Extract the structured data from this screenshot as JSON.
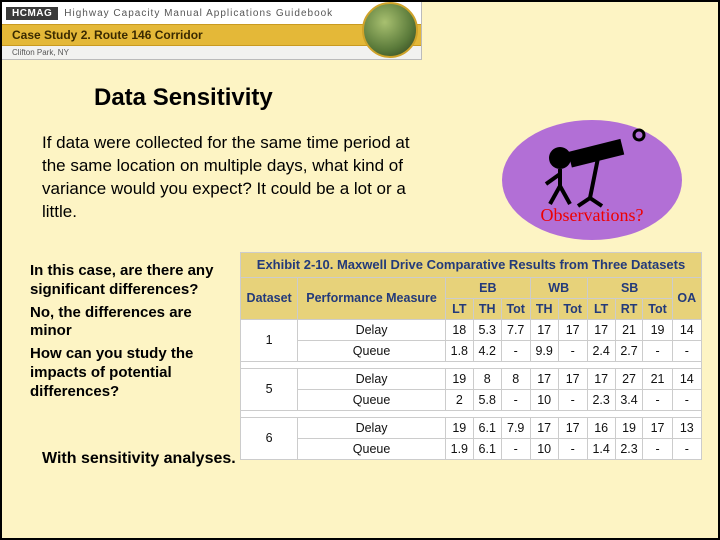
{
  "header": {
    "badge": "HCMAG",
    "line1": "Highway Capacity Manual Applications Guidebook",
    "line2": "Case Study 2. Route 146 Corridor",
    "line3": "Clifton Park, NY"
  },
  "title": "Data Sensitivity",
  "question1": "If data were collected for the same time period at the same location on multiple days, what kind of variance would you expect?",
  "answer1": "It could be a lot or a little.",
  "bubble_label": "Observations?",
  "qa": {
    "q2": "In this case, are there any significant differences?",
    "a2": "No, the differences are minor",
    "q3": "How can you study the impacts of potential differences?",
    "a3": "With sensitivity analyses."
  },
  "exhibit": {
    "title": "Exhibit 2-10. Maxwell Drive Comparative Results from Three Datasets",
    "group_headers": {
      "dataset": "Dataset",
      "pm": "Performance Measure",
      "eb": "EB",
      "wb": "WB",
      "sb": "SB",
      "oa": "OA"
    },
    "sub_headers": {
      "eb": [
        "LT",
        "TH",
        "Tot"
      ],
      "wb": [
        "TH",
        "Tot"
      ],
      "sb": [
        "LT",
        "RT",
        "Tot"
      ]
    },
    "measures": {
      "delay": "Delay",
      "queue": "Queue"
    },
    "rows": [
      {
        "dataset": "1",
        "delay": [
          "18",
          "5.3",
          "7.7",
          "17",
          "17",
          "17",
          "21",
          "19",
          "14"
        ],
        "queue": [
          "1.8",
          "4.2",
          "-",
          "9.9",
          "-",
          "2.4",
          "2.7",
          "-",
          "-"
        ]
      },
      {
        "dataset": "5",
        "delay": [
          "19",
          "8",
          "8",
          "17",
          "17",
          "17",
          "27",
          "21",
          "14"
        ],
        "queue": [
          "2",
          "5.8",
          "-",
          "10",
          "-",
          "2.3",
          "3.4",
          "-",
          "-"
        ]
      },
      {
        "dataset": "6",
        "delay": [
          "19",
          "6.1",
          "7.9",
          "17",
          "17",
          "16",
          "19",
          "17",
          "13"
        ],
        "queue": [
          "1.9",
          "6.1",
          "-",
          "10",
          "-",
          "1.4",
          "2.3",
          "-",
          "-"
        ]
      }
    ]
  }
}
